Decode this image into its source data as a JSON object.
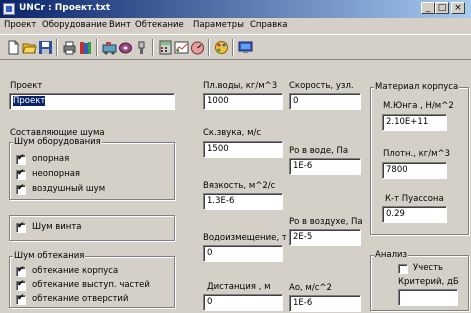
{
  "window": {
    "title": "UNCr : Проект.txt"
  },
  "menu": {
    "items": [
      {
        "u": "П",
        "rest": "роект"
      },
      {
        "u": "О",
        "rest": "борудование"
      },
      {
        "u": "В",
        "rest": "инт"
      },
      {
        "u": "",
        "pre": "Об",
        "mid": "т",
        "rest": "екание"
      },
      {
        "u": "",
        "pre": "Па",
        "mid": "р",
        "rest": "аметры"
      },
      {
        "u": "С",
        "rest": "правка"
      }
    ]
  },
  "menu_labels": [
    "Проект",
    "Оборудование",
    "Винт",
    "Обтекание",
    "Параметры",
    "Справка"
  ],
  "toolbar": {
    "icons": [
      "new-file-icon",
      "open-folder-icon",
      "save-icon",
      "print-icon",
      "books-icon",
      "equipment-icon",
      "disc-icon",
      "flashlight-icon",
      "calculator-icon",
      "chart-icon",
      "gauge-icon",
      "palette-icon",
      "monitor-icon"
    ]
  },
  "project": {
    "label": "Проект",
    "value": "Проект"
  },
  "noise_components": {
    "label": "Составляющие шума"
  },
  "equipment_noise": {
    "label": "Шум оборудования",
    "items": [
      {
        "label": "опорная",
        "checked": true
      },
      {
        "label": "неопорная",
        "checked": true
      },
      {
        "label": "воздушный шум",
        "checked": true
      }
    ]
  },
  "propeller_noise": {
    "label": "Шум винта",
    "checked": true
  },
  "flow_noise": {
    "label": "Шум обтекания",
    "items": [
      {
        "label": "обтекание корпуса",
        "checked": true
      },
      {
        "label": "обтекание выступ. частей",
        "checked": true
      },
      {
        "label": "обтекание отверстий",
        "checked": true
      }
    ]
  },
  "water_density": {
    "label": "Пл.воды, кг/м^3",
    "value": "1000"
  },
  "sound_speed": {
    "label": "Ск.звука, м/с",
    "value": "1500"
  },
  "viscosity": {
    "label": "Вязкость, м^2/с",
    "value": "1.3E-6"
  },
  "displacement": {
    "label": "Водоизмещение, т",
    "value": "0"
  },
  "distance": {
    "label": "Дистанция , м",
    "value": "0"
  },
  "speed": {
    "label": "Скорость, узл.",
    "value": "0"
  },
  "p_water": {
    "label": "Ро в воде, Па",
    "value": "1E-6"
  },
  "p_air": {
    "label": "Ро в воздухе, Па",
    "value": "2E-5"
  },
  "a0": {
    "label": "Ао, м/с^2",
    "value": "1E-6"
  },
  "hull_material": {
    "label": "Материал корпуса",
    "young": {
      "label": "М.Юнга , Н/м^2",
      "value": "2.10E+11"
    },
    "density": {
      "label": "Плотн., кг/м^3",
      "value": "7800"
    },
    "poisson": {
      "label": "К-т Пуассона",
      "value": "0.29"
    }
  },
  "analysis": {
    "label": "Анализ",
    "consider": {
      "label": "Учесть",
      "checked": false
    },
    "criterion": {
      "label": "Критерий, дБ",
      "value": ""
    }
  }
}
